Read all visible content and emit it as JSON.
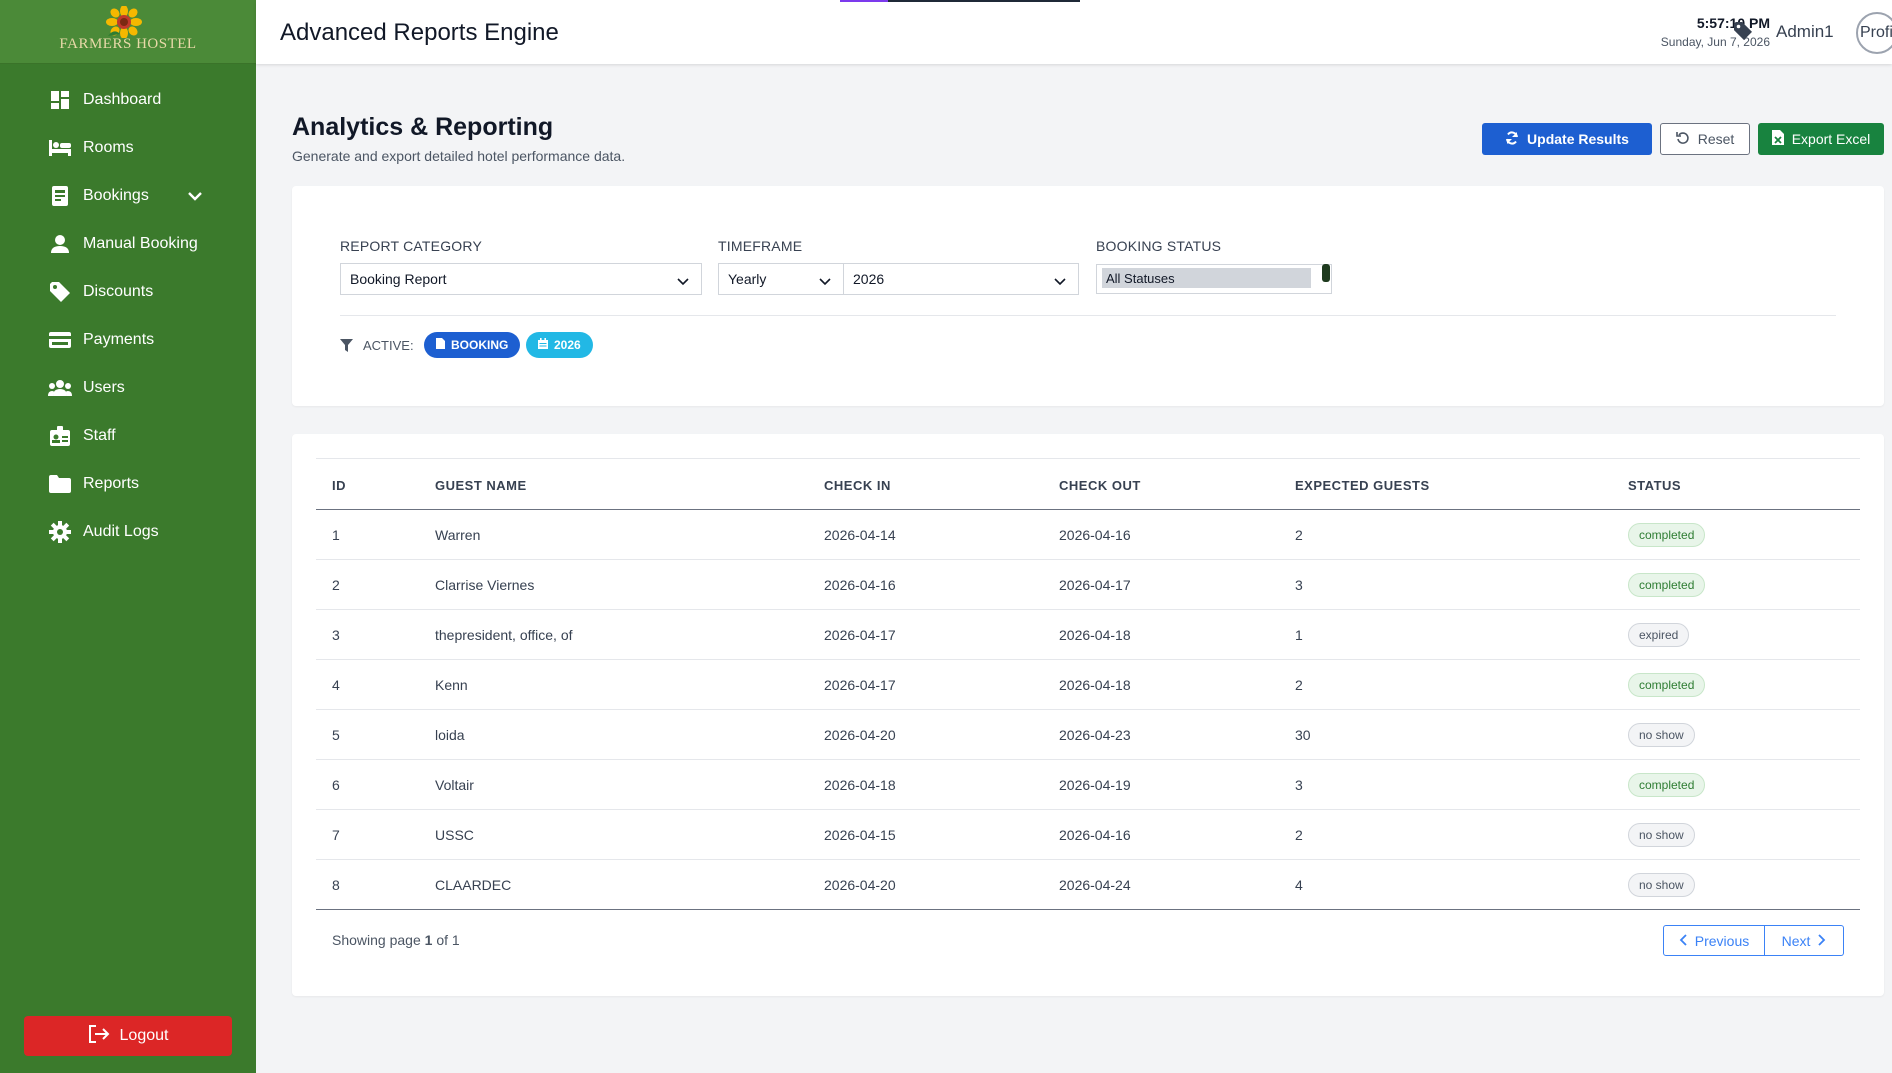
{
  "brand": {
    "name": "FARMERS HOSTEL"
  },
  "header": {
    "title": "Advanced Reports Engine",
    "time": "5:57:10 PM",
    "date": "Sunday, Jun 7, 2026",
    "user": "Admin1",
    "avatar_alt": "Profi"
  },
  "sidebar": {
    "items": [
      {
        "label": "Dashboard",
        "icon": "dashboard-icon"
      },
      {
        "label": "Rooms",
        "icon": "bed-icon"
      },
      {
        "label": "Bookings",
        "icon": "booking-icon"
      },
      {
        "label": "Manual Booking",
        "icon": "user-icon"
      },
      {
        "label": "Discounts",
        "icon": "tag-icon"
      },
      {
        "label": "Payments",
        "icon": "credit-card-icon"
      },
      {
        "label": "Users",
        "icon": "users-icon"
      },
      {
        "label": "Staff",
        "icon": "id-badge-icon"
      },
      {
        "label": "Reports",
        "icon": "folder-icon"
      },
      {
        "label": "Audit Logs",
        "icon": "gear-icon"
      }
    ],
    "logout": "Logout"
  },
  "page": {
    "title": "Analytics & Reporting",
    "subtitle": "Generate and export detailed hotel performance data.",
    "buttons": {
      "update": "Update Results",
      "reset": "Reset",
      "export": "Export Excel"
    }
  },
  "filters": {
    "category_label": "REPORT CATEGORY",
    "category_value": "Booking Report",
    "timeframe_label": "TIMEFRAME",
    "timeframe_value": "Yearly",
    "year_value": "2026",
    "status_label": "BOOKING STATUS",
    "status_value": "All Statuses",
    "active_label": "ACTIVE:",
    "chips": [
      "BOOKING",
      "2026"
    ]
  },
  "table": {
    "columns": [
      "ID",
      "GUEST NAME",
      "CHECK IN",
      "CHECK OUT",
      "EXPECTED GUESTS",
      "STATUS"
    ],
    "rows": [
      [
        "1",
        "Warren",
        "2026-04-14",
        "2026-04-16",
        "2",
        "completed"
      ],
      [
        "2",
        "Clarrise Viernes",
        "2026-04-16",
        "2026-04-17",
        "3",
        "completed"
      ],
      [
        "3",
        "thepresident, office, of",
        "2026-04-17",
        "2026-04-18",
        "1",
        "expired"
      ],
      [
        "4",
        "Kenn",
        "2026-04-17",
        "2026-04-18",
        "2",
        "completed"
      ],
      [
        "5",
        "loida",
        "2026-04-20",
        "2026-04-23",
        "30",
        "no show"
      ],
      [
        "6",
        "Voltair",
        "2026-04-18",
        "2026-04-19",
        "3",
        "completed"
      ],
      [
        "7",
        "USSC",
        "2026-04-15",
        "2026-04-16",
        "2",
        "no show"
      ],
      [
        "8",
        "CLAARDEC",
        "2026-04-20",
        "2026-04-24",
        "4",
        "no show"
      ]
    ]
  },
  "pagination": {
    "showing_prefix": "Showing page",
    "current": "1",
    "of_text": "of",
    "total": "1",
    "prev": "Previous",
    "next": "Next"
  }
}
